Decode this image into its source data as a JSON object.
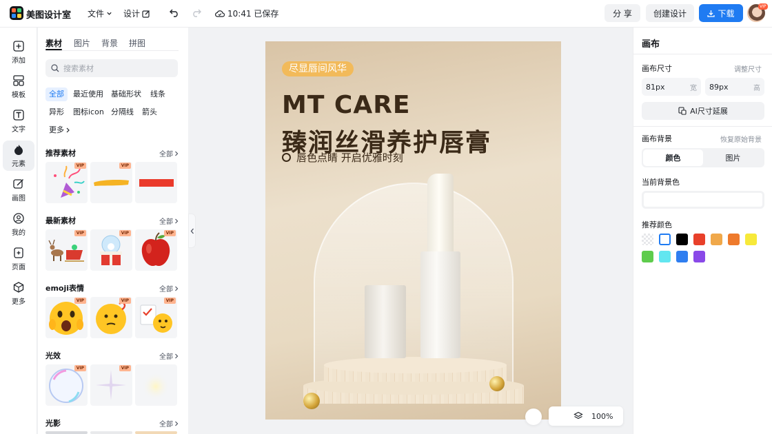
{
  "app": {
    "name": "美图设计室",
    "logo_colors": [
      "#ff6a3d",
      "#3ad17a",
      "#2b8bff",
      "#ffd23b"
    ]
  },
  "topbar": {
    "file_menu": "文件",
    "design_menu": "设计",
    "save_status": "10:41 已保存",
    "share": "分 享",
    "create_design": "创建设计",
    "download": "下载",
    "avatar_badge": "VIP"
  },
  "rail": [
    {
      "label": "添加",
      "icon": "add-icon"
    },
    {
      "label": "模板",
      "icon": "template-icon"
    },
    {
      "label": "文字",
      "icon": "text-icon"
    },
    {
      "label": "元素",
      "icon": "element-icon",
      "active": true
    },
    {
      "label": "画图",
      "icon": "draw-icon"
    },
    {
      "label": "我的",
      "icon": "user-icon"
    },
    {
      "label": "页面",
      "icon": "page-icon"
    },
    {
      "label": "更多",
      "icon": "more-icon"
    }
  ],
  "panel": {
    "tabs": [
      "素材",
      "图片",
      "背景",
      "拼图"
    ],
    "search_placeholder": "搜索素材",
    "chips": [
      "全部",
      "最近使用",
      "基础形状",
      "线条",
      "异形",
      "图标icon",
      "分隔线",
      "箭头",
      "更多"
    ],
    "sections": [
      {
        "title": "推荐素材",
        "all": "全部"
      },
      {
        "title": "最新素材",
        "all": "全部"
      },
      {
        "title": "emoji表情",
        "all": "全部"
      },
      {
        "title": "光效",
        "all": "全部"
      },
      {
        "title": "光影",
        "all": "全部"
      }
    ],
    "vip_label": "VIP"
  },
  "canvas": {
    "tagline": "尽显唇间风华",
    "brand": "MT CARE",
    "headline": "臻润丝滑养护唇膏",
    "slogan": "唇色点睛 开启优雅时刻",
    "zoom": "100%"
  },
  "right_panel": {
    "title": "画布",
    "size_label": "画布尺寸",
    "adjust_size": "调整尺寸",
    "width_value": "81px",
    "width_unit": "宽",
    "height_value": "89px",
    "height_unit": "高",
    "ai_extend": "AI尺寸延展",
    "bg_label": "画布背景",
    "restore_bg": "恢复原始背景",
    "seg_color": "颜色",
    "seg_image": "图片",
    "current_bg": "当前背景色",
    "recommended": "推荐颜色",
    "colors": [
      "#ffffff",
      "#000000",
      "#e8402a",
      "#f0a84a",
      "#ee7a2c",
      "#f7e93a",
      "#5ecc4c",
      "#62e6f0",
      "#2f7ef0",
      "#8a49e8"
    ]
  }
}
